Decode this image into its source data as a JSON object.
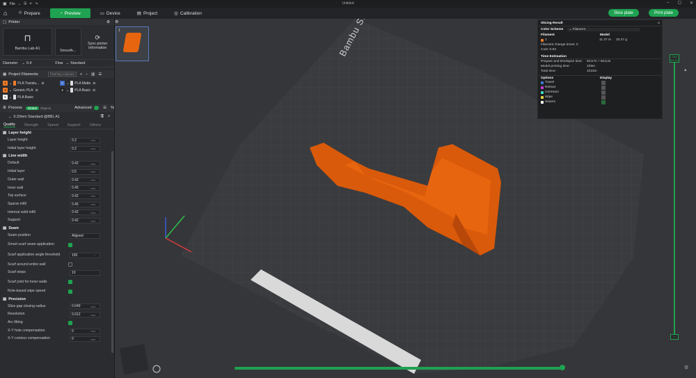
{
  "window": {
    "title": "Untitled",
    "file_menu": "File"
  },
  "nav": {
    "tabs": [
      "Prepare",
      "Preview",
      "Device",
      "Project",
      "Calibration"
    ],
    "active": "Preview",
    "slice_button": "Slice plate",
    "print_button": "Print plate"
  },
  "printer": {
    "section": "Printer",
    "name": "Bambu Lab A1",
    "plate": "Smooth...",
    "sync": "Sync printer information",
    "diameter_label": "Diameter",
    "diameter": "0.4",
    "flow_label": "Flow",
    "flow": "Standard"
  },
  "filaments": {
    "section": "Project Filaments",
    "flush_btn": "Flushing volumes",
    "items": [
      {
        "num": "1",
        "name": "PLA Translu...",
        "color": "#f07c28"
      },
      {
        "num": "2",
        "name": "PLA Matte",
        "color": "#3f6fd0"
      },
      {
        "num": "3",
        "name": "Generic PLA",
        "color": "#f07c28"
      },
      {
        "num": "4",
        "name": "PLA Basic",
        "color": "#222222"
      },
      {
        "num": "5",
        "name": "PLA Basic",
        "color": "#ffffff"
      }
    ]
  },
  "process": {
    "section": "Process",
    "global": "Global",
    "objects": "Objects",
    "advanced": "Advanced",
    "preset": "0.20mm Standard @BBL A1",
    "tabs": [
      "Quality",
      "Strength",
      "Speed",
      "Support",
      "Others"
    ],
    "active_tab": "Quality",
    "groups": [
      {
        "title": "Layer height",
        "rows": [
          {
            "label": "Layer height",
            "value": "0.2",
            "unit": "mm"
          },
          {
            "label": "Initial layer height",
            "value": "0.2",
            "unit": "mm"
          }
        ]
      },
      {
        "title": "Line width",
        "rows": [
          {
            "label": "Default",
            "value": "0.42",
            "unit": "mm"
          },
          {
            "label": "Initial layer",
            "value": "0.5",
            "unit": "mm"
          },
          {
            "label": "Outer wall",
            "value": "0.42",
            "unit": "mm"
          },
          {
            "label": "Inner wall",
            "value": "0.45",
            "unit": "mm"
          },
          {
            "label": "Top surface",
            "value": "0.42",
            "unit": "mm"
          },
          {
            "label": "Sparse infill",
            "value": "0.45",
            "unit": "mm"
          },
          {
            "label": "Internal solid infill",
            "value": "0.42",
            "unit": "mm"
          },
          {
            "label": "Support",
            "value": "0.42",
            "unit": "mm"
          }
        ]
      },
      {
        "title": "Seam",
        "rows": [
          {
            "label": "Seam position",
            "value": "Aligned",
            "unit": ""
          },
          {
            "label": "Smart scarf seam application",
            "check": true
          },
          {
            "label": "Scarf application angle threshold",
            "value": "155",
            "unit": "°"
          },
          {
            "label": "Scarf around entire wall",
            "check": false
          },
          {
            "label": "Scarf steps",
            "value": "10",
            "unit": ""
          },
          {
            "label": "Scarf joint for inner walls",
            "check": true
          },
          {
            "label": "Role-based wipe speed",
            "check": true
          }
        ]
      },
      {
        "title": "Precision",
        "rows": [
          {
            "label": "Slice gap closing radius",
            "value": "0.049",
            "unit": "mm"
          },
          {
            "label": "Resolution",
            "value": "0.012",
            "unit": "mm"
          },
          {
            "label": "Arc fitting",
            "check": true
          },
          {
            "label": "X-Y hole compensation",
            "value": "0",
            "unit": "mm"
          },
          {
            "label": "X-Y contour compensation",
            "value": "0",
            "unit": "mm"
          }
        ]
      }
    ]
  },
  "plate": {
    "number": "1",
    "text": "Bambu Smooth PEI Plate | High Temp Plate",
    "bottom_text": "PLA-PETG-ABS-TPU-PC"
  },
  "slicing": {
    "title": "Slicing Result",
    "scheme_label": "Color Scheme",
    "scheme": "Filament",
    "col_filament": "Filament",
    "col_model": "Model",
    "filament_row": {
      "id": "1",
      "length": "11.37 m",
      "weight": "33.37 g"
    },
    "change_times": "Filament change times: 0",
    "cost": "Cost: 0.93",
    "time_title": "Time Estimation",
    "prepare": "Prepare and timelapse time:",
    "prepare_val": "6m17s + 8m14s",
    "model_time": "Model printing time:",
    "model_time_val": "1h8m",
    "total": "Total time:",
    "total_val": "1h23m",
    "options_label": "Options",
    "display_label": "Display",
    "options": [
      {
        "name": "Travel",
        "color": "#3b7bd8"
      },
      {
        "name": "Retract",
        "color": "#c23bd8"
      },
      {
        "name": "Unretract",
        "color": "#3bd8c8"
      },
      {
        "name": "Wipe",
        "color": "#e8d23b"
      },
      {
        "name": "Seams",
        "color": "#ffffff"
      }
    ]
  },
  "slider": {
    "top": "258",
    "bottom": "1",
    "top_sub": "51.60"
  }
}
